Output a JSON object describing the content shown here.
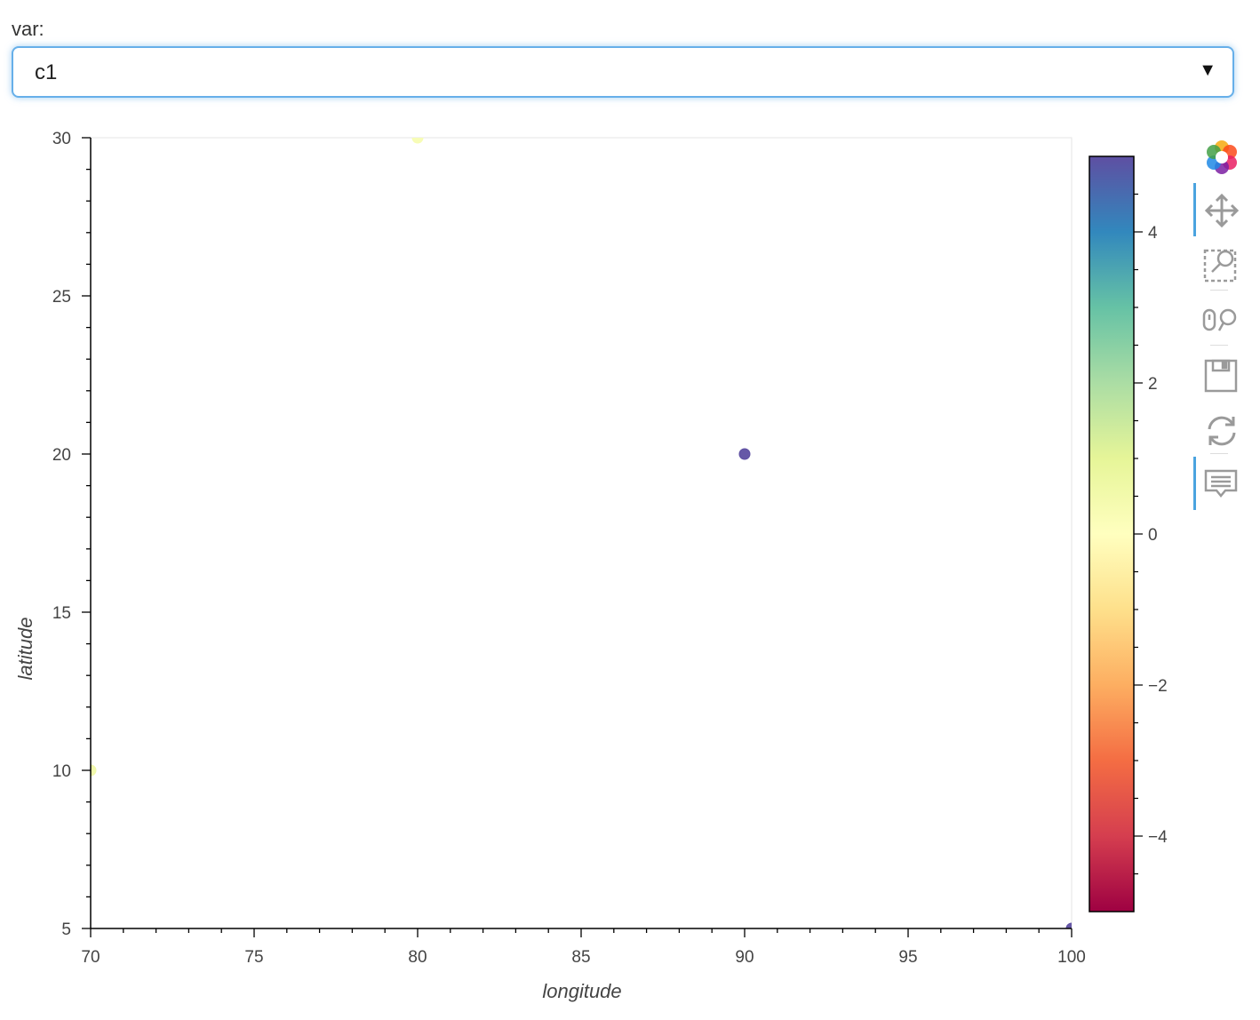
{
  "widget": {
    "label": "var:",
    "selected": "c1"
  },
  "icons": {
    "logo": "bokeh-logo-icon",
    "caret": "caret-down-icon",
    "pan": "pan-move-icon",
    "box_zoom": "box-zoom-icon",
    "wheel_zoom": "wheel-zoom-icon",
    "save": "save-disk-icon",
    "reset": "reset-icon",
    "hover": "hover-tooltip-icon"
  },
  "chart_data": {
    "type": "scatter",
    "xlabel": "longitude",
    "ylabel": "latitude",
    "xlim": [
      70,
      100
    ],
    "ylim": [
      5,
      30
    ],
    "x_ticks": [
      "70",
      "75",
      "80",
      "85",
      "90",
      "95",
      "100"
    ],
    "y_ticks": [
      "5",
      "10",
      "15",
      "20",
      "25",
      "30"
    ],
    "points": [
      {
        "x": 80,
        "y": 30,
        "value": 0.3
      },
      {
        "x": 90,
        "y": 20,
        "value": 5
      },
      {
        "x": 70,
        "y": 10,
        "value": 0.6
      },
      {
        "x": 100,
        "y": 5,
        "value": 5
      }
    ],
    "colorbar": {
      "low": -5,
      "high": 5,
      "ticks": [
        "−4",
        "−2",
        "0",
        "2",
        "4"
      ],
      "tick_values": [
        -4,
        -2,
        0,
        2,
        4
      ],
      "palette": [
        "#9e0142",
        "#d53e4f",
        "#f46d43",
        "#fdae61",
        "#fee08b",
        "#ffffbf",
        "#e6f598",
        "#abdda4",
        "#66c2a5",
        "#3288bd",
        "#5e4fa2"
      ]
    },
    "grid": false
  }
}
